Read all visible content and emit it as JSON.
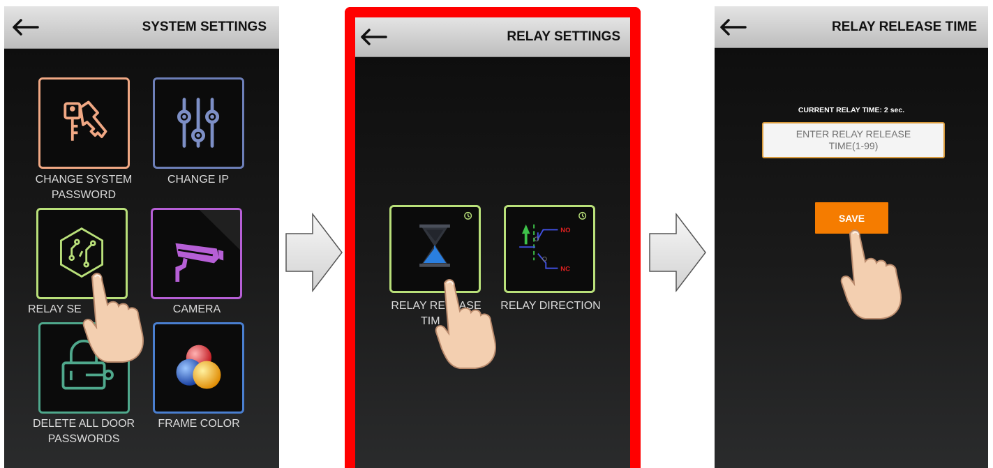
{
  "screen1": {
    "title": "SYSTEM SETTINGS",
    "items": [
      {
        "label": "CHANGE SYSTEM PASSWORD",
        "color": "#f0a884"
      },
      {
        "label": "CHANGE IP",
        "color": "#6d7fb8"
      },
      {
        "label": "RELAY SE",
        "color": "#b9e07a"
      },
      {
        "label": "CAMERA",
        "color": "#b65fd6"
      },
      {
        "label": "DELETE ALL DOOR PASSWORDS",
        "color": "#4fa88c"
      },
      {
        "label": "FRAME COLOR",
        "color": "#4a7fd0"
      }
    ]
  },
  "screen2": {
    "title": "RELAY SETTINGS",
    "highlight_color": "#ff0000",
    "items": [
      {
        "label_line1": "RELAY RE",
        "label_line1b": "EASE",
        "label_line2": "TIM",
        "color": "#b9e07a"
      },
      {
        "label": "RELAY DIRECTION",
        "color": "#b9e07a",
        "no": "NO",
        "nc": "NC"
      }
    ]
  },
  "screen3": {
    "title": "RELAY RELEASE TIME",
    "current_time_text": "CURRENT RELAY TIME: 2 sec.",
    "input_placeholder": "ENTER RELAY RELEASE TIME(1-99)",
    "save_label": "SAVE",
    "save_color": "#f57c00"
  },
  "icons": {
    "back": "arrow-left-icon",
    "next": "arrow-right-icon",
    "hand": "pointing-hand-icon"
  }
}
